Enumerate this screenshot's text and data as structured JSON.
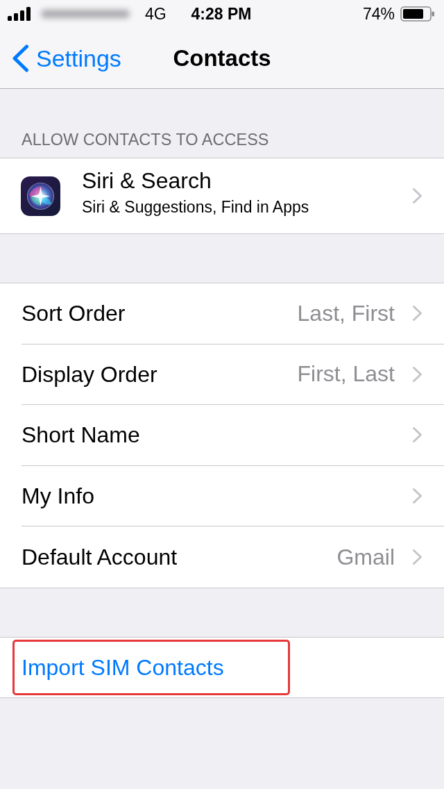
{
  "status_bar": {
    "carrier_blurred": true,
    "network": "4G",
    "time": "4:28 PM",
    "battery": "74%"
  },
  "nav_bar": {
    "back": "Settings",
    "title": "Contacts"
  },
  "sections": [
    {
      "header": "ALLOW CONTACTS TO ACCESS",
      "rows": [
        {
          "kind": "app",
          "title": "Siri & Search",
          "subtitle": "Siri & Suggestions, Find in Apps",
          "chevron": true,
          "highlighted": false
        }
      ]
    },
    {
      "rows": [
        {
          "kind": "detail",
          "title": "Sort Order",
          "value": "Last, First",
          "chevron": true,
          "highlighted": false
        },
        {
          "kind": "detail",
          "title": "Display Order",
          "value": "First, Last",
          "chevron": true,
          "highlighted": false
        },
        {
          "kind": "detail",
          "title": "Short Name",
          "chevron": true,
          "highlighted": false
        },
        {
          "kind": "detail",
          "title": "My Info",
          "chevron": true,
          "highlighted": false
        },
        {
          "kind": "detail",
          "title": "Default Account",
          "value": "Gmail",
          "chevron": true,
          "highlighted": false
        }
      ]
    },
    {
      "rows": [
        {
          "kind": "action",
          "title": "Import SIM Contacts",
          "chevron": false,
          "highlighted": true
        }
      ]
    }
  ]
}
